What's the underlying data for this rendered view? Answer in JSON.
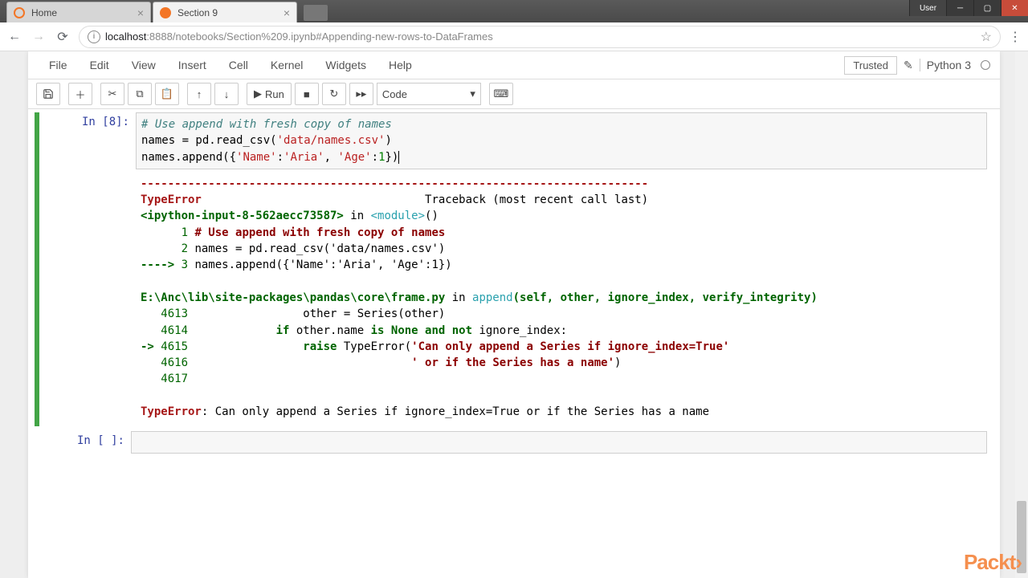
{
  "window": {
    "user_btn": "User"
  },
  "tabs": [
    {
      "title": "Home",
      "active": false
    },
    {
      "title": "Section 9",
      "active": true
    }
  ],
  "url": {
    "host": "localhost",
    "port_path": ":8888/notebooks/Section%209.ipynb#Appending-new-rows-to-DataFrames"
  },
  "menubar": [
    "File",
    "Edit",
    "View",
    "Insert",
    "Cell",
    "Kernel",
    "Widgets",
    "Help"
  ],
  "trusted": "Trusted",
  "kernel": "Python 3",
  "toolbar": {
    "run": "Run",
    "celltype": "Code"
  },
  "cell8": {
    "prompt": "In [8]:",
    "code_line1_comment": "# Use append with fresh copy of names",
    "code_line2_a": "names = pd.read_csv(",
    "code_line2_str": "'data/names.csv'",
    "code_line2_b": ")",
    "code_line3_a": "names.append({",
    "code_line3_k1": "'Name'",
    "code_line3_c1": ":",
    "code_line3_v1": "'Aria'",
    "code_line3_c2": ", ",
    "code_line3_k2": "'Age'",
    "code_line3_c3": ":",
    "code_line3_v2": "1",
    "code_line3_b": "})"
  },
  "traceback": {
    "dash": "---------------------------------------------------------------------------",
    "errname": "TypeError",
    "trace_hdr": "Traceback (most recent call last)",
    "loc1_a": "<ipython-input-8-562aecc73587>",
    "loc1_b": " in ",
    "loc1_mod": "<module>",
    "loc1_c": "()",
    "l1_num": "1",
    "l1_code": " # Use append with fresh copy of names",
    "l2_num": "2",
    "l2_code": " names = pd.read_csv('data/names.csv')",
    "arrow": "----> ",
    "l3_num": "3",
    "l3_code": " names.append({'Name':'Aria', 'Age':1})",
    "loc2_path": "E:\\Anc\\lib\\site-packages\\pandas\\core\\frame.py",
    "loc2_in": " in ",
    "loc2_fn": "append",
    "loc2_sig": "(self, other, ignore_index, verify_integrity)",
    "f1_num": "4613",
    "f1_code": "                 other = Series(other)",
    "f2_num": "4614",
    "f2_code_a": "             if",
    "f2_code_b": " other.name ",
    "f2_code_c": "is None and not",
    "f2_code_d": " ignore_index:",
    "farrow": "-> ",
    "f3_num": "4615",
    "f3_code_a": "                 raise",
    "f3_code_b": " TypeError(",
    "f3_code_c": "'Can only append a Series if ignore_index=True'",
    "f4_num": "4616",
    "f4_code_a": "                                 ",
    "f4_code_b": "' or if the Series has a name'",
    "f4_code_c": ")",
    "f5_num": "4617",
    "final_err": "TypeError",
    "final_msg": ": Can only append a Series if ignore_index=True or if the Series has a name"
  },
  "empty_prompt": "In [ ]:",
  "watermark": "Packt",
  "watermark_arrow": "›"
}
